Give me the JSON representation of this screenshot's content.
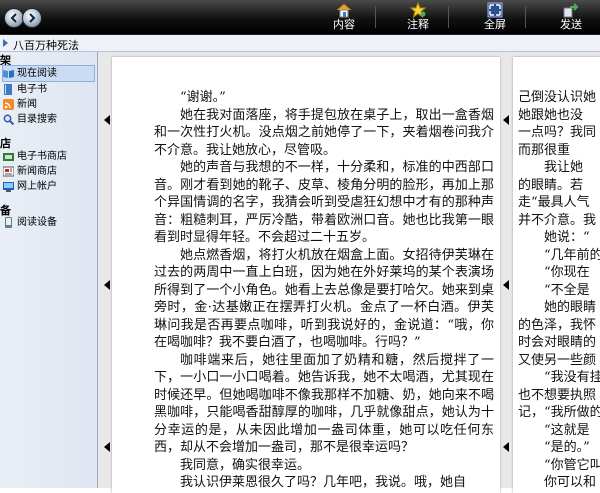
{
  "toolbar": {
    "buttons": [
      {
        "label": "内容",
        "icon": "house-icon"
      },
      {
        "label": "注释",
        "icon": "star-icon"
      },
      {
        "label": "全屏",
        "icon": "fullscreen-icon"
      },
      {
        "label": "发送",
        "icon": "send-icon"
      }
    ]
  },
  "breadcrumb": {
    "title": "八百万种死法"
  },
  "sidebar": {
    "sections": [
      {
        "label": "架",
        "items": [
          {
            "label": "现在阅读",
            "icon": "book-open-icon",
            "selected": true
          },
          {
            "label": "电子书",
            "icon": "book-icon"
          },
          {
            "label": "新闻",
            "icon": "rss-icon"
          },
          {
            "label": "目录搜索",
            "icon": "search-icon"
          }
        ]
      },
      {
        "label": "店",
        "items": [
          {
            "label": "电子书商店",
            "icon": "store-icon"
          },
          {
            "label": "新闻商店",
            "icon": "news-store-icon"
          },
          {
            "label": "网上帐户",
            "icon": "account-icon"
          }
        ]
      },
      {
        "label": "备",
        "items": [
          {
            "label": "阅读设备",
            "icon": "device-icon"
          }
        ]
      }
    ]
  },
  "page_left": {
    "paragraphs": [
      "“谢谢。”",
      "她在我对面落座，将手提包放在桌子上，取出一盒香烟和一次性打火机。没点烟之前她停了一下，夹着烟卷问我介不介意。我让她放心，尽管吸。",
      "她的声音与我想的不一样，十分柔和，标准的中西部口音。刚才看到她的靴子、皮草、棱角分明的脸形，再加上那个异国情调的名字，我猜会听到受虐狂幻想中才有的那种声音：粗糙刺耳，严厉冷酷，带着欧洲口音。她也比我第一眼看到时显得年轻。不会超过二十五岁。",
      "她点燃香烟，将打火机放在烟盒上面。女招待伊芙琳在过去的两周中一直上白班，因为她在外好莱坞的某个表演场所得到了一个小角色。她看上去总像是要打哈欠。她来到桌旁时，金·达基嫩正在摆弄打火机。金点了一杯白酒。伊芙琳问我是否再要点咖啡，听到我说好的，金说道：“哦，你在喝咖啡？我不要白酒了，也喝咖啡。行吗？”",
      "咖啡端来后，她往里面加了奶精和糖，然后搅拌了一下，一小口一小口喝着。她告诉我，她不太喝酒，尤其现在时候还早。但她喝咖啡不像我那样不加糖、奶，她向来不喝黑咖啡，只能喝香甜醇厚的咖啡，几乎就像甜点，她认为十分幸运的是，从未因此增加一盎司体重，她可以吃任何东西，却从不会增加一盎司，那不是很幸运吗？",
      "我同意，确实很幸运。",
      "我认识伊莱恩很久了吗？几年吧，我说。哦，她自"
    ]
  },
  "page_right": {
    "paragraphs": [
      {
        "text": "己倒没认识她",
        "indent": false
      },
      {
        "text": "她跟她也没",
        "indent": false
      },
      {
        "text": "一点吗？我同",
        "indent": false
      },
      {
        "text": "而那很重",
        "indent": false
      },
      {
        "text": "我让她",
        "indent": true
      },
      {
        "text": "的眼睛。若",
        "indent": false
      },
      {
        "text": "走“最具人气",
        "indent": false
      },
      {
        "text": "并不介意。我",
        "indent": false
      },
      {
        "text": "她说：“",
        "indent": true
      },
      {
        "text": "“几年前的",
        "indent": true
      },
      {
        "text": "“你现在",
        "indent": true
      },
      {
        "text": "“不全是",
        "indent": true
      },
      {
        "text": "她的眼睛",
        "indent": true
      },
      {
        "text": "的色泽，我怀",
        "indent": false
      },
      {
        "text": "时会对眼睛的",
        "indent": false
      },
      {
        "text": "又使另一些颜",
        "indent": false
      },
      {
        "text": "“我没有挂",
        "indent": true
      },
      {
        "text": "也不想要执照",
        "indent": false
      },
      {
        "text": "记，“我所做的",
        "indent": false
      },
      {
        "text": "“这就是",
        "indent": true
      },
      {
        "text": "“是的。”",
        "indent": true
      },
      {
        "text": "“你管它叫",
        "indent": true
      },
      {
        "text": "你可以和",
        "indent": true
      }
    ]
  }
}
